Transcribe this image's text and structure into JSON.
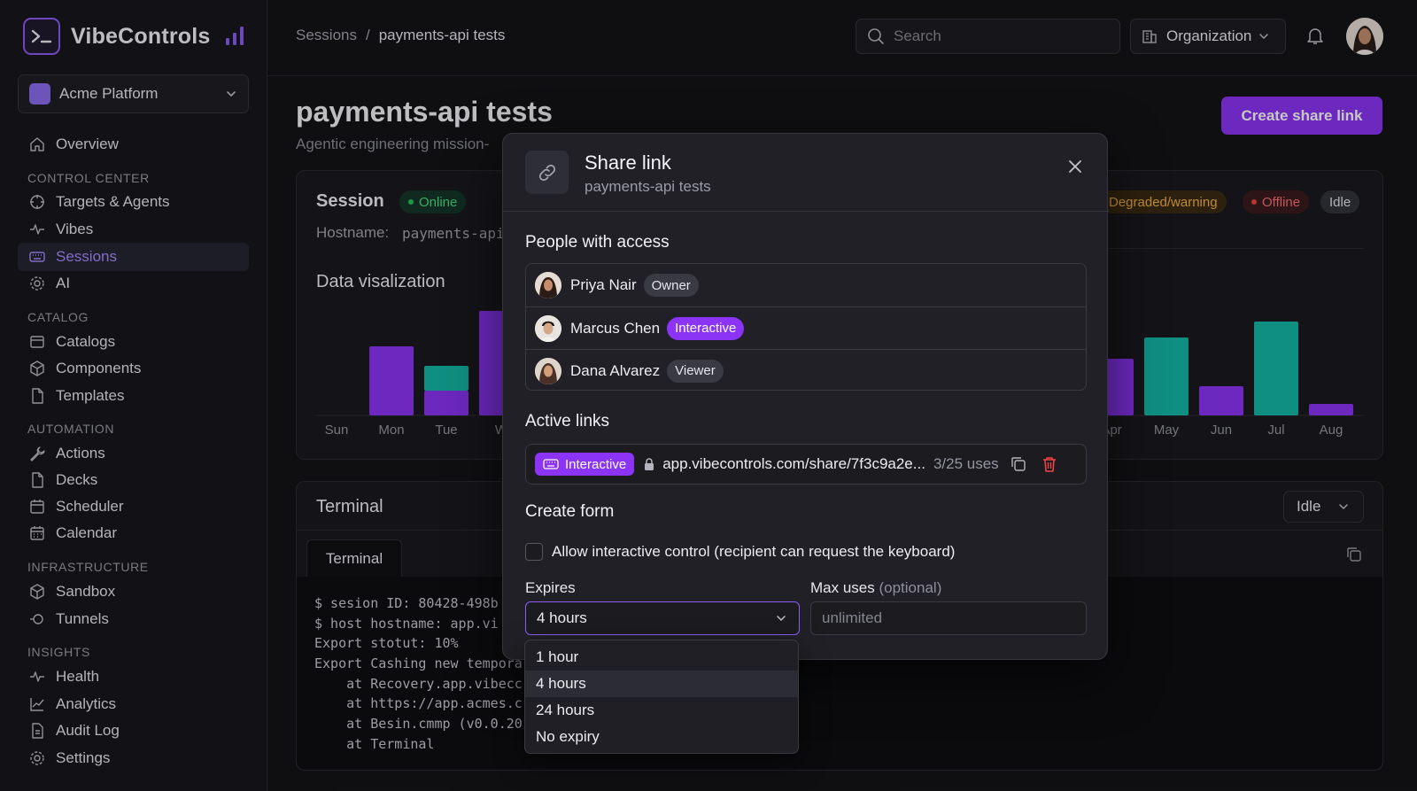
{
  "brand": {
    "name": "VibeControls",
    "accent": "#8b5cf6"
  },
  "workspace": {
    "name": "Acme Platform"
  },
  "sidebar": {
    "overview": "Overview",
    "sections": {
      "control_center": "CONTROL CENTER",
      "catalog": "CATALOG",
      "automation": "AUTOMATION",
      "infrastructure": "INFRASTRUCTURE",
      "insights": "INSIGHTS"
    },
    "items": {
      "targets": "Targets & Agents",
      "vibes": "Vibes",
      "sessions": "Sessions",
      "ai": "AI",
      "catalogs": "Catalogs",
      "components": "Components",
      "templates": "Templates",
      "actions": "Actions",
      "decks": "Decks",
      "scheduler": "Scheduler",
      "calendar": "Calendar",
      "sandbox": "Sandbox",
      "tunnels": "Tunnels",
      "health": "Health",
      "analytics": "Analytics",
      "audit_log": "Audit Log",
      "settings": "Settings"
    },
    "active": "Sessions"
  },
  "breadcrumb": {
    "root": "Sessions",
    "sep": "/",
    "current": "payments-api tests"
  },
  "search": {
    "placeholder": "Search"
  },
  "org": {
    "label": "Organization"
  },
  "page": {
    "title": "payments-api tests",
    "subtitle": "Agentic engineering mission-",
    "create_button": "Create share link"
  },
  "session_card": {
    "title": "Session",
    "status": "Online",
    "hostname_label": "Hostname:",
    "hostname_value": "payments-api",
    "status_badges": [
      "Degraded/warning",
      "Offline",
      "Idle"
    ],
    "chart_title": "Data vi­salization"
  },
  "chart_data": [
    {
      "type": "bar",
      "categories": [
        "Sun",
        "Mon",
        "Tue",
        "W"
      ],
      "series": [
        {
          "values": [
            0,
            78,
            28,
            118
          ],
          "color": "#8b34f5"
        },
        {
          "values": [
            0,
            0,
            28,
            0
          ],
          "color": "#14b8a6"
        }
      ]
    },
    {
      "type": "bar",
      "categories": [
        "Apr",
        "May",
        "Jun",
        "Jul",
        "Aug"
      ],
      "series": [
        {
          "values": [
            64,
            88,
            33,
            106,
            13
          ],
          "colors": [
            "#8b34f5",
            "#14b8a6",
            "#8b34f5",
            "#14b8a6",
            "#8b34f5"
          ]
        }
      ]
    }
  ],
  "terminal_card": {
    "title": "Terminal",
    "select_value": "Idle",
    "tab": "Terminal",
    "lines": [
      "$ sesion ID: 80428-498b",
      "$ host hostname: app.vi",
      "Export stotut: 10%",
      "Export Cashing new tempora",
      "    at Recovery.app.vibecc",
      "    at https://app.acmes.c",
      "    at Besin.cmmp (v0.0.20",
      "    at Terminal"
    ]
  },
  "modal": {
    "title": "Share link",
    "subtitle": "payments-api tests",
    "people_heading": "People with access",
    "people": [
      {
        "name": "Priya Nair",
        "role": "Owner"
      },
      {
        "name": "Marcus Chen",
        "role": "Interactive"
      },
      {
        "name": "Dana Alvarez",
        "role": "Viewer"
      }
    ],
    "links_heading": "Active links",
    "link": {
      "mode": "Interactive",
      "url": "app.vibecontrols.com/share/7f3c9a2e...",
      "uses": "3/25 uses"
    },
    "form_heading": "Create form",
    "checkbox_label": "Allow interactive control (recipient can request the keyboard)",
    "expires_label": "Expires",
    "expires_value": "4 hours",
    "max_uses_label": "Max uses",
    "max_uses_optional": "(optional)",
    "max_uses_placeholder": "unlimited",
    "expires_options": [
      "1 hour",
      "4 hours",
      "24 hours",
      "No expiry"
    ]
  },
  "colors": {
    "purple": "#8b34f5",
    "teal": "#14b8a6",
    "online": "#22c55e",
    "offline": "#ef4444",
    "warning": "#f59e0b"
  }
}
